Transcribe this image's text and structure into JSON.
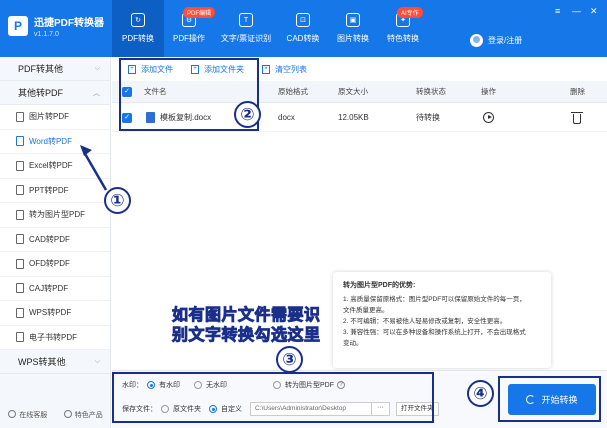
{
  "app": {
    "logo_char": "P",
    "name": "迅捷PDF转换器",
    "version": "v1.1.7.0"
  },
  "tabs": [
    {
      "label": "PDF转换",
      "badge": "",
      "icon": "refresh-icon",
      "icon_char": "↻"
    },
    {
      "label": "PDF操作",
      "badge": "PDF编辑",
      "icon": "settings-icon",
      "icon_char": "⚙"
    },
    {
      "label": "文字/票证识别",
      "badge": "",
      "icon": "text-icon",
      "icon_char": "T"
    },
    {
      "label": "CAD转换",
      "badge": "",
      "icon": "cad-icon",
      "icon_char": "⊡"
    },
    {
      "label": "图片转换",
      "badge": "",
      "icon": "image-icon",
      "icon_char": "▣"
    },
    {
      "label": "特色转换",
      "badge": "AI专作",
      "icon": "star-icon",
      "icon_char": "✦"
    }
  ],
  "user": {
    "login_label": "登录/注册"
  },
  "window_controls": {
    "menu": "≡",
    "minimize": "—",
    "close": "✕"
  },
  "sidebar": {
    "group1": "PDF转其他",
    "group2": "其他转PDF",
    "group3": "WPS转其他",
    "items": [
      "图片转PDF",
      "Word转PDF",
      "Excel转PDF",
      "PPT转PDF",
      "转为图片型PDF",
      "CAD转PDF",
      "OFD转PDF",
      "CAJ转PDF",
      "WPS转PDF",
      "电子书转PDF"
    ],
    "online_service": "在线客服",
    "featured": "特色产品"
  },
  "toolbar": {
    "add_file": "添加文件",
    "add_folder": "添加文件夹",
    "clear_list": "清空列表"
  },
  "table": {
    "headers": {
      "name": "文件名",
      "format": "原始格式",
      "size": "原文大小",
      "status": "转换状态",
      "action": "操作",
      "delete": "删除"
    },
    "rows": [
      {
        "name": "模板复制.docx",
        "format": "docx",
        "size": "12.05KB",
        "status": "待转换"
      }
    ]
  },
  "tips": {
    "title": "转为图片型PDF的优势:",
    "lines": [
      "1. 高质量保留原格式：图片型PDF可以保留原始文件的每一页，",
      "文件质量更高。",
      "2. 不可编辑：不易被他人轻易修改或复制，安全性更高。",
      "3. 兼容性强：可以在多种设备和操作系统上打开，不会出现格式",
      "变动。"
    ]
  },
  "options": {
    "watermark_label": "水印：",
    "watermark_on": "有水印",
    "watermark_off": "无水印",
    "image_pdf": "转为图片型PDF",
    "help": "?",
    "save_label": "保存文件：",
    "save_source": "原文件夹",
    "save_custom": "自定义",
    "path": "C:\\Users\\Administrator\\Desktop",
    "browse": "···",
    "open_folder": "打开文件夹"
  },
  "start_button": "开始转换",
  "annotations": {
    "n1": "①",
    "n2": "②",
    "n3": "③",
    "n4": "④",
    "caption_line1": "如有图片文件需要识",
    "caption_line2": "别文字转换勾选这里"
  }
}
